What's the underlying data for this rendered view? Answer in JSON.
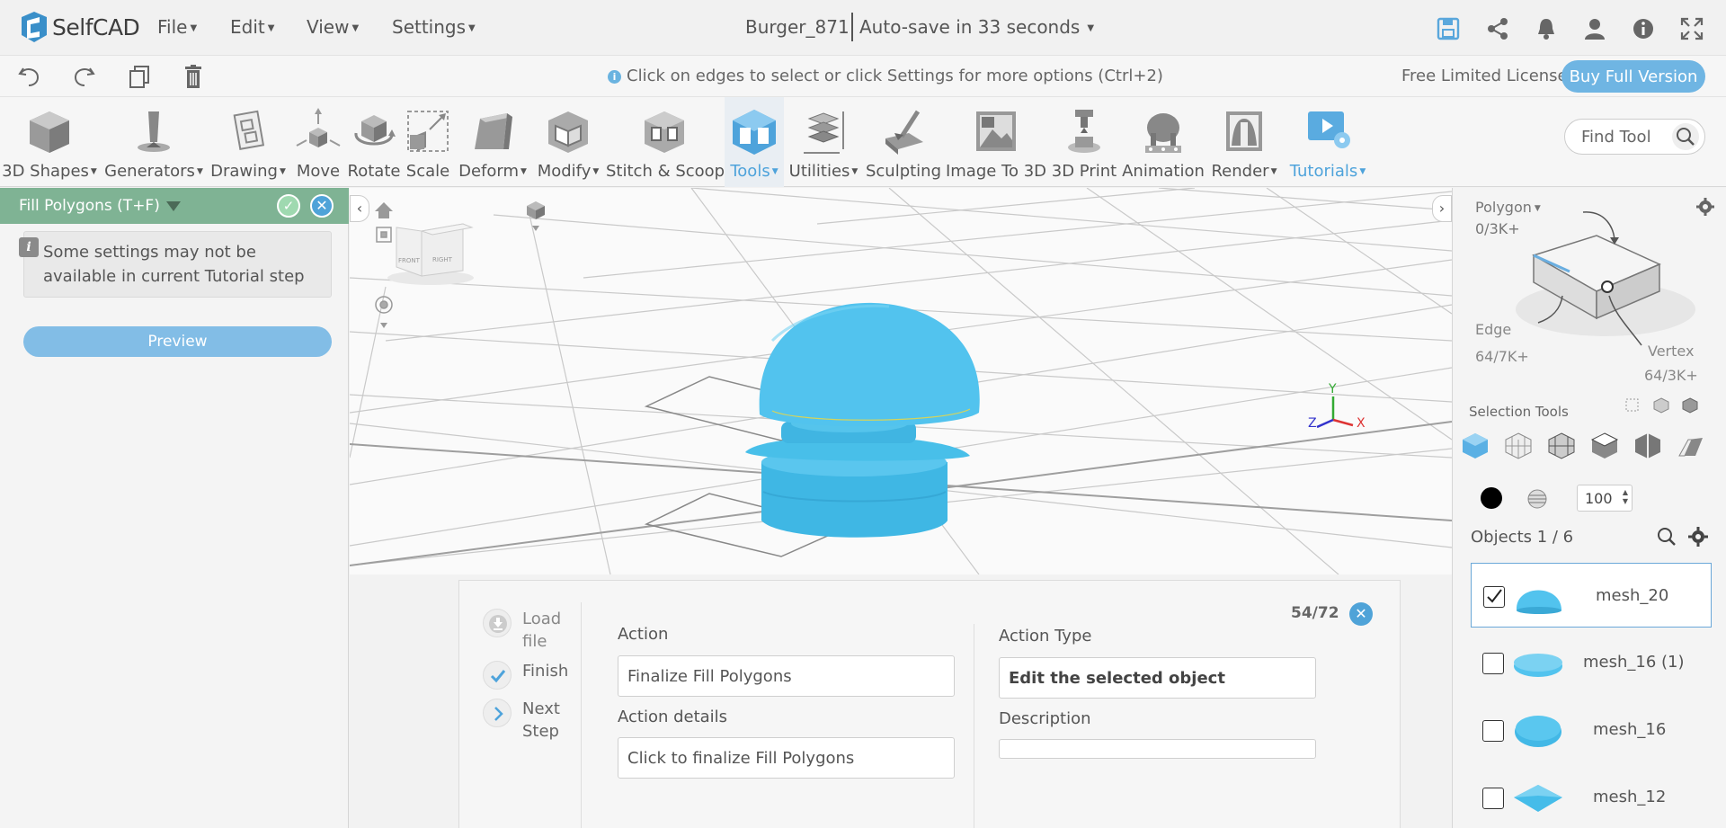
{
  "app": {
    "logo_text": "SelfCAD",
    "menus": [
      {
        "label": "File"
      },
      {
        "label": "Edit"
      },
      {
        "label": "View"
      },
      {
        "label": "Settings"
      }
    ],
    "doc_title": "Burger_871",
    "autosave": "Auto-save in 33 seconds",
    "top_icons": [
      "save-icon",
      "share-icon",
      "bell-icon",
      "user-icon",
      "info-icon",
      "fullscreen-icon"
    ]
  },
  "secondary": {
    "hint": "Click on edges to select or click Settings for more options (Ctrl+2)",
    "license": "Free Limited License",
    "buy_label": "Buy Full Version",
    "icons": [
      "undo-icon",
      "redo-icon",
      "copy-icon",
      "delete-icon"
    ]
  },
  "toolbar": {
    "tools": [
      {
        "label": "3D Shapes",
        "dropdown": true
      },
      {
        "label": "Generators",
        "dropdown": true
      },
      {
        "label": "Drawing",
        "dropdown": true
      },
      {
        "label": "Move",
        "dropdown": false
      },
      {
        "label": "Rotate",
        "dropdown": false
      },
      {
        "label": "Scale",
        "dropdown": false
      },
      {
        "label": "Deform",
        "dropdown": true
      },
      {
        "label": "Modify",
        "dropdown": true
      },
      {
        "label": "Stitch & Scoop",
        "dropdown": false
      },
      {
        "label": "Tools",
        "dropdown": true
      },
      {
        "label": "Utilities",
        "dropdown": true
      },
      {
        "label": "Sculpting",
        "dropdown": false
      },
      {
        "label": "Image To 3D",
        "dropdown": false
      },
      {
        "label": "3D Print",
        "dropdown": false
      },
      {
        "label": "Animation",
        "dropdown": false
      },
      {
        "label": "Render",
        "dropdown": true
      },
      {
        "label": "Tutorials",
        "dropdown": true
      }
    ],
    "find_tool_placeholder": "Find Tool",
    "accent": "#4ea3db"
  },
  "left_panel": {
    "title": "Fill Polygons (T+F)",
    "note": "Some settings may not be available in current Tutorial step",
    "preview_label": "Preview",
    "header_color": "#7fb394"
  },
  "viewport": {
    "cube_faces": [
      "FRONT",
      "RIGHT"
    ],
    "axes": {
      "x": "X",
      "y": "Y",
      "z": "Z"
    },
    "model_color": "#4fc3ea"
  },
  "tutorial": {
    "steps": [
      {
        "label": "Load file"
      },
      {
        "label": "Finish"
      },
      {
        "label": "Next Step"
      }
    ],
    "counter": "54/72",
    "action_label": "Action",
    "action_value": "Finalize Fill Polygons",
    "action_details_label": "Action details",
    "action_details_value": "Click to finalize Fill Polygons",
    "action_type_label": "Action Type",
    "action_type_value": "Edit the selected object",
    "description_label": "Description",
    "description_value": ""
  },
  "right_panel": {
    "mode": "Polygon",
    "polygon_count": "0/3K+",
    "edge_label": "Edge",
    "edge_count": "64/7K+",
    "vertex_label": "Vertex",
    "vertex_count": "64/3K+",
    "selection_tools_label": "Selection Tools",
    "size_value": "100",
    "objects_label": "Objects 1 / 6",
    "objects": [
      {
        "name": "mesh_20",
        "checked": true
      },
      {
        "name": "mesh_16 (1)",
        "checked": false
      },
      {
        "name": "mesh_16",
        "checked": false
      },
      {
        "name": "mesh_12",
        "checked": false
      }
    ]
  }
}
